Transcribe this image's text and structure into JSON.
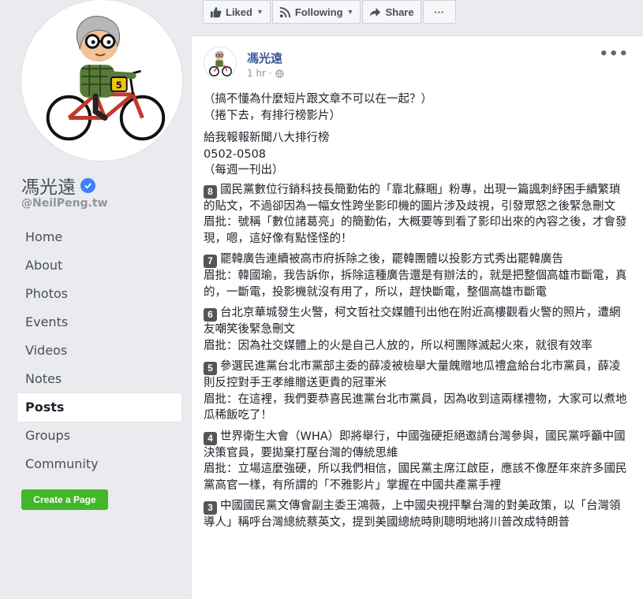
{
  "page": {
    "name": "馮光遠",
    "handle": "@NeilPeng.tw",
    "verified_icon": "check-icon",
    "brand_color": "#4080ff"
  },
  "nav": {
    "items": [
      {
        "label": "Home",
        "active": false
      },
      {
        "label": "About",
        "active": false
      },
      {
        "label": "Photos",
        "active": false
      },
      {
        "label": "Events",
        "active": false
      },
      {
        "label": "Videos",
        "active": false
      },
      {
        "label": "Notes",
        "active": false
      },
      {
        "label": "Posts",
        "active": true
      },
      {
        "label": "Groups",
        "active": false
      },
      {
        "label": "Community",
        "active": false
      }
    ],
    "create_page_label": "Create a Page"
  },
  "actions": {
    "liked_label": "Liked",
    "following_label": "Following",
    "share_label": "Share",
    "more_label": "···"
  },
  "post": {
    "author": "馮光遠",
    "time": "1 hr ·",
    "audience_icon": "globe-icon",
    "menu_label": "•••",
    "intro": [
      "（搞不懂為什麼短片跟文章不可以在一起？）",
      "（捲下去，有排行榜影片）"
    ],
    "heading": [
      "給我報報新聞八大排行榜",
      "0502-0508",
      "（每週一刊出）"
    ],
    "items": [
      {
        "rank": "8",
        "text": "國民黨數位行銷科技長簡勤佑的「靠北蘇睏」粉專，出現一篇諷刺紓困手續繁瑣的貼文，不過卻因為一幅女性跨坐影印機的圖片涉及歧視，引發眾怒之後緊急刪文",
        "comment": "眉批：號稱「數位諸葛亮」的簡勤佑，大概要等到看了影印出來的內容之後，才會發現，嗯，這好像有點怪怪的！"
      },
      {
        "rank": "7",
        "text": "罷韓廣告連續被高市府拆除之後，罷韓團體以投影方式秀出罷韓廣告",
        "comment": "眉批：韓國瑜，我告訴你，拆除這種廣告還是有辦法的，就是把整個高雄市斷電，真的，一斷電，投影機就沒有用了，所以，趕快斷電，整個高雄市斷電"
      },
      {
        "rank": "6",
        "text": "台北京華城發生火警，柯文哲社交媒體刊出他在附近高樓觀看火警的照片，遭網友嘲笑後緊急刪文",
        "comment": "眉批：因為社交媒體上的火是自己人放的，所以柯團隊滅起火來，就很有效率"
      },
      {
        "rank": "5",
        "text": "參選民進黨台北市黨部主委的薛凌被檢舉大量餽贈地瓜禮盒給台北市黨員，薛凌則反控對手王孝維贈送更貴的冠軍米",
        "comment": "眉批：在這裡，我們要恭喜民進黨台北市黨員，因為收到這兩樣禮物，大家可以煮地瓜稀飯吃了！"
      },
      {
        "rank": "4",
        "text": "世界衛生大會（WHA）即將舉行，中國強硬拒絕邀請台灣參與，國民黨呼籲中國決策官員，要拋棄打壓台灣的傳統思維",
        "comment": "眉批：立場這麼強硬，所以我們相信，國民黨主席江啟臣，應該不像歷年來許多國民黨高官一樣，有所謂的「不雅影片」掌握在中國共產黨手裡"
      },
      {
        "rank": "3",
        "text": "中國國民黨文傳會副主委王鴻薇，上中國央視抨擊台灣的對美政策，以「台灣領導人」稱呼台灣總統蔡英文，提到美國總統時則聰明地將川普改成特朗普",
        "comment": ""
      }
    ]
  }
}
